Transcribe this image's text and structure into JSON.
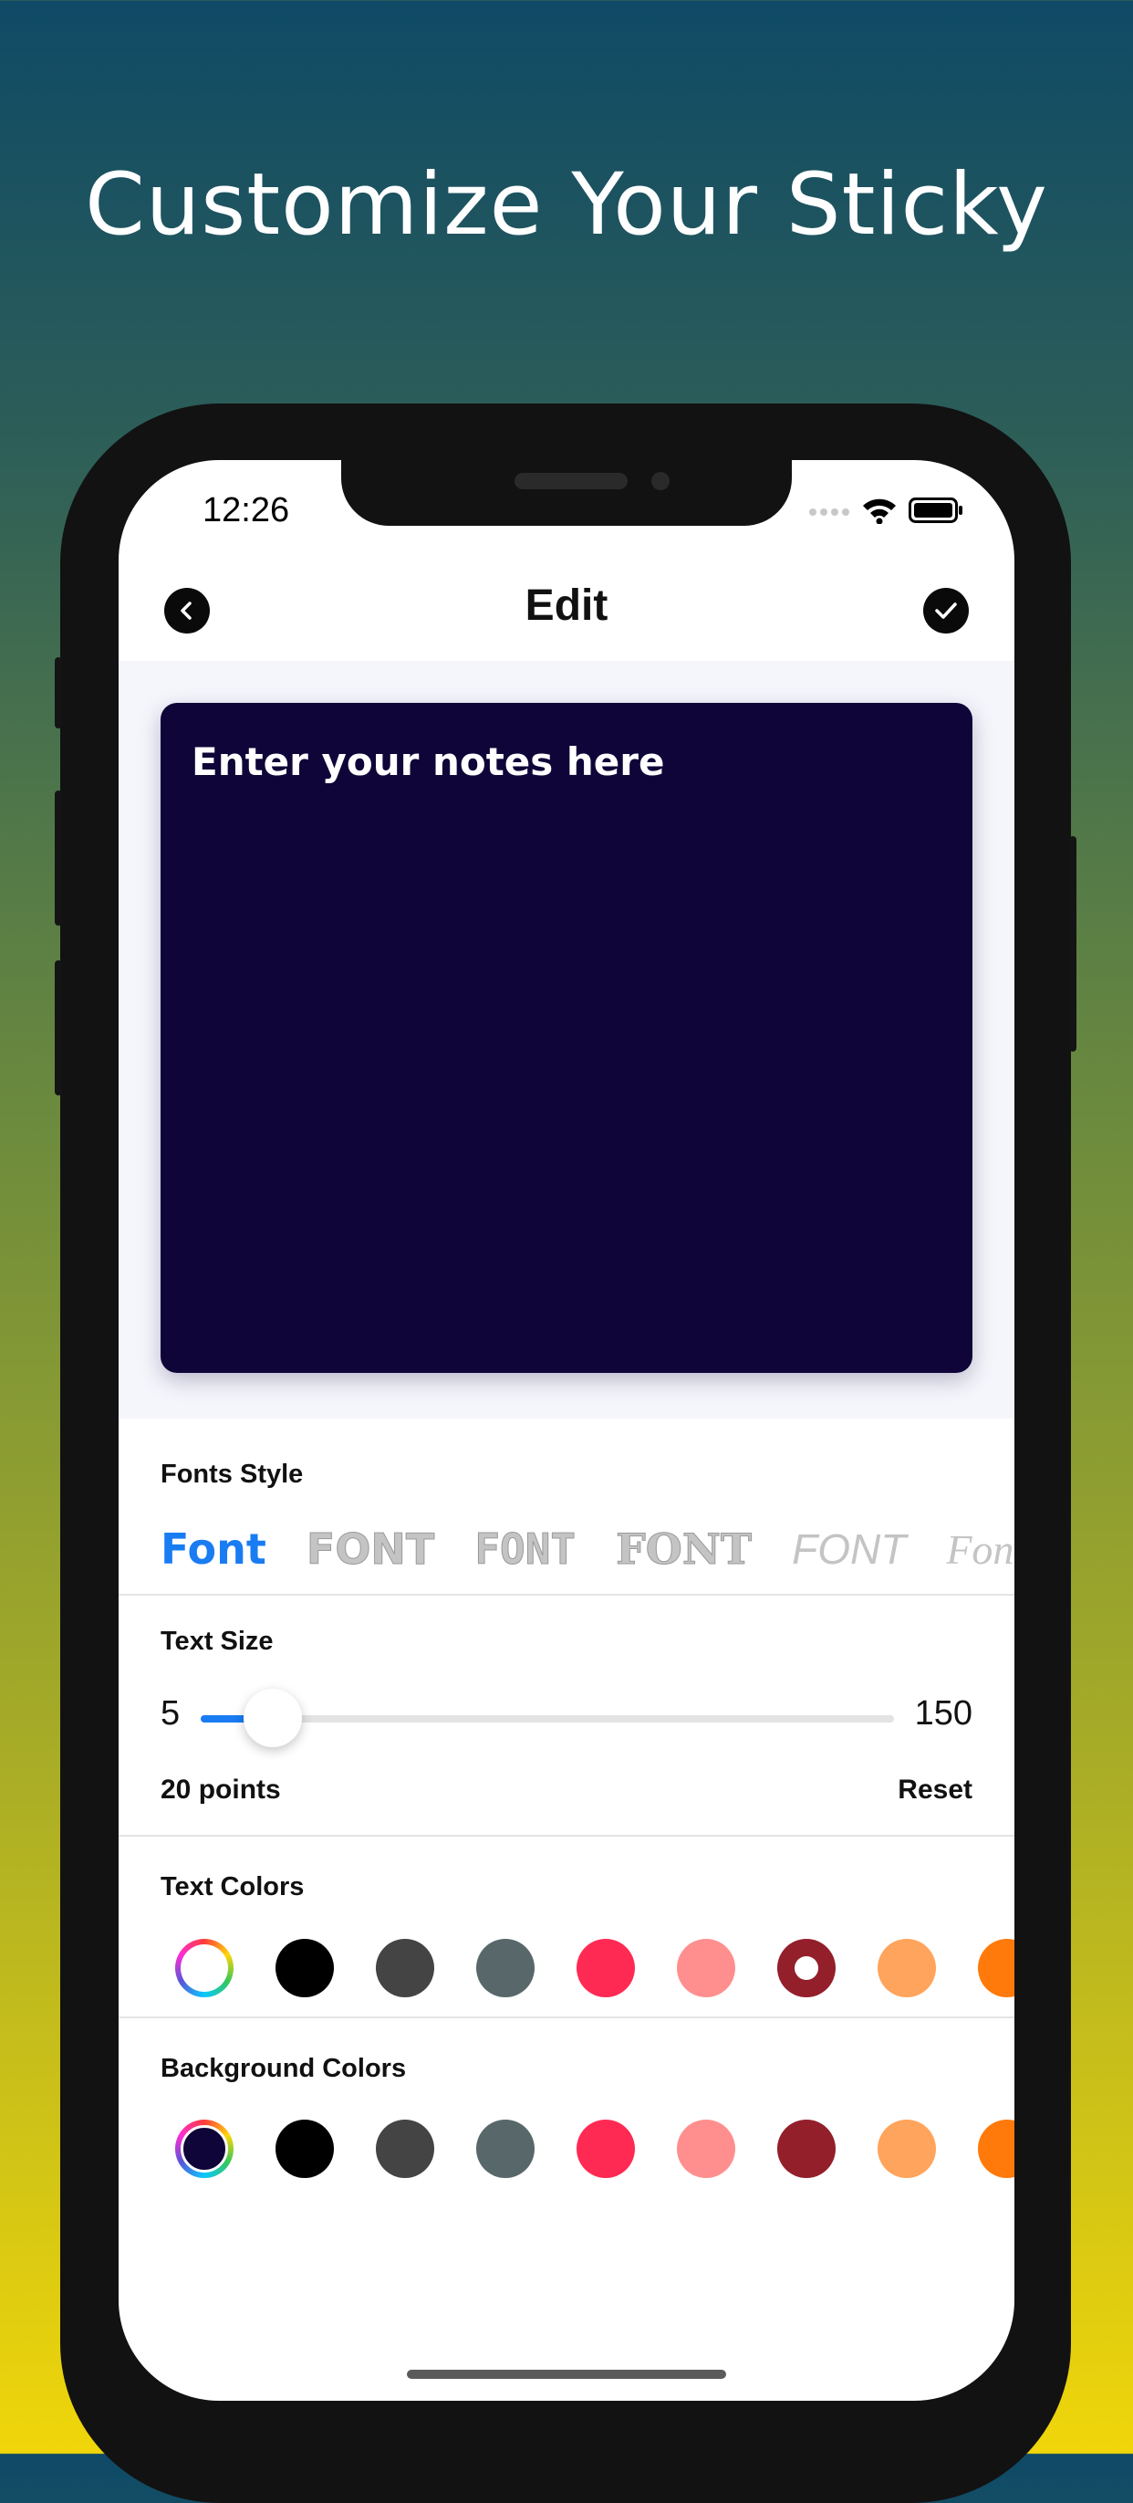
{
  "headline": "Customize Your Sticky",
  "status_bar": {
    "time": "12:26"
  },
  "nav": {
    "title": "Edit",
    "back_icon": "chevron-left-icon",
    "done_icon": "checkmark-icon"
  },
  "note": {
    "placeholder": "Enter your notes here",
    "background_color": "#0f0538",
    "text_color": "#ffffff"
  },
  "fonts_style": {
    "label": "Fonts Style",
    "options": [
      "Font",
      "FONT",
      "FONT",
      "FONT",
      "FONT",
      "Fon"
    ],
    "selected_index": 0
  },
  "text_size": {
    "label": "Text Size",
    "min": "5",
    "max": "150",
    "value": 20,
    "value_label": "20 points",
    "reset_label": "Reset",
    "accent_color": "#1a7cf2"
  },
  "text_colors": {
    "label": "Text Colors",
    "swatches": [
      "picker",
      "#000000",
      "#444444",
      "#58676a",
      "#ff2a54",
      "#ff8f8f",
      "#931f2b",
      "#ffa45c",
      "#ff7a0a"
    ],
    "selected_index": 6
  },
  "background_colors": {
    "label": "Background Colors",
    "swatches": [
      "picker",
      "#000000",
      "#444444",
      "#58676a",
      "#ff2a54",
      "#ff8f8f",
      "#931f2b",
      "#ffa45c",
      "#ff7a0a"
    ],
    "selected_index": 0
  }
}
